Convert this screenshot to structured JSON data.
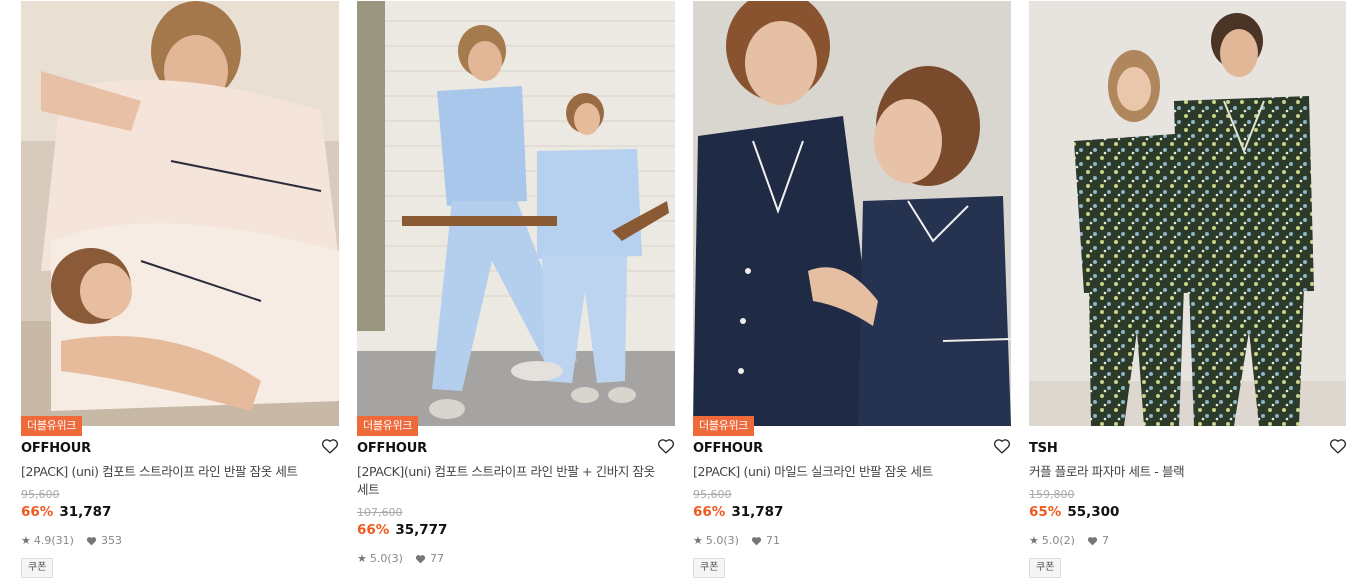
{
  "products": [
    {
      "badge": "더블유위크",
      "brand": "OFFHOUR",
      "name": "[2PACK] (uni) 컴포트 스트라이프 라인 반팔 잠옷 세트",
      "original_price": "95,600",
      "discount": "66%",
      "price": "31,787",
      "rating": "4.9",
      "reviews": "(31)",
      "likes": "353",
      "coupon": "쿠폰",
      "image_desc": "couple in light pink pajamas lounging"
    },
    {
      "badge": "더블유위크",
      "brand": "OFFHOUR",
      "name": "[2PACK](uni) 컴포트 스트라이프 라인 반팔 + 긴바지 잠옷 세트",
      "original_price": "107,600",
      "discount": "66%",
      "price": "35,777",
      "rating": "5.0",
      "reviews": "(3)",
      "likes": "77",
      "coupon": "",
      "image_desc": "couple in light blue pajamas sitting on chairs"
    },
    {
      "badge": "더블유위크",
      "brand": "OFFHOUR",
      "name": "[2PACK] (uni) 마일드 실크라인 반팔 잠옷 세트",
      "original_price": "95,600",
      "discount": "66%",
      "price": "31,787",
      "rating": "5.0",
      "reviews": "(3)",
      "likes": "71",
      "coupon": "쿠폰",
      "image_desc": "couple in navy pajamas"
    },
    {
      "badge": "",
      "brand": "TSH",
      "name": "커플 플로라 파자마 세트 - 블랙",
      "original_price": "159,800",
      "discount": "65%",
      "price": "55,300",
      "rating": "5.0",
      "reviews": "(2)",
      "likes": "7",
      "coupon": "쿠폰",
      "image_desc": "couple in black floral pajamas"
    }
  ],
  "colors": {
    "badge_bg": "#ef6a3a",
    "discount": "#ef5a1f",
    "photo1": "#efe3da",
    "photo2": "#c9d9ec",
    "photo3": "#2a3550",
    "photo4": "#2f3b2e"
  }
}
